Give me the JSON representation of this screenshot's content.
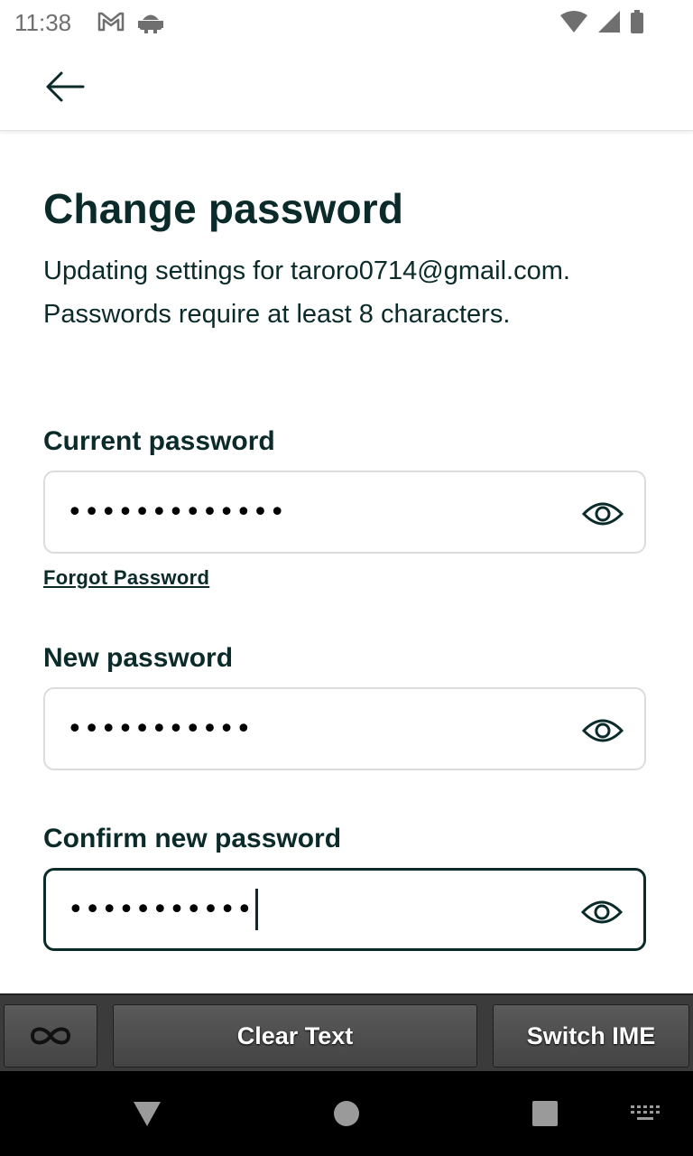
{
  "status_bar": {
    "time": "11:38",
    "left_icons": [
      "gmail-icon",
      "android-icon"
    ],
    "right_icons": [
      "wifi-icon",
      "signal-icon",
      "battery-icon"
    ]
  },
  "app_bar": {
    "back_icon": "arrow-left-icon"
  },
  "page": {
    "title": "Change password",
    "description": "Updating settings for taroro0714@gmail.com. Passwords require at least 8 characters."
  },
  "fields": {
    "current": {
      "label": "Current password",
      "value": "•••••••••••••",
      "icon": "eye-icon"
    },
    "forgot_link": "Forgot Password",
    "new": {
      "label": "New password",
      "value": "•••••••••••",
      "icon": "eye-icon"
    },
    "confirm": {
      "label": "Confirm new password",
      "value": "•••••••••••",
      "icon": "eye-icon"
    }
  },
  "ime_bar": {
    "left_icon": "infinity-icon",
    "clear_text": "Clear Text",
    "switch_ime": "Switch IME"
  },
  "nav_bar": {
    "icons": [
      "back-triangle-icon",
      "home-circle-icon",
      "recents-square-icon",
      "keyboard-icon"
    ]
  },
  "colors": {
    "text": "#0b2a2a",
    "focus_border": "#0b2a2a",
    "field_border": "#dcdcdc"
  }
}
